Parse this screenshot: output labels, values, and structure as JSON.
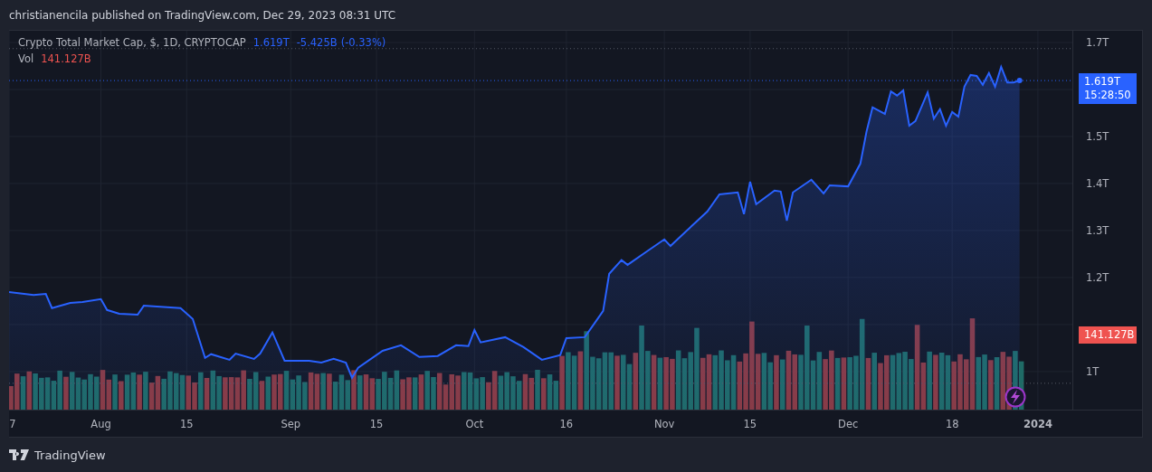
{
  "header": {
    "text": "christianencila published on TradingView.com, Dec 29, 2023 08:31 UTC"
  },
  "legend": {
    "price": "1.619T",
    "change": "-5.425B",
    "change_percent": "(-0.33%)",
    "volume_label": "Vol",
    "volume": "141.127B"
  },
  "price_badge": {
    "price": "1.619T",
    "countdown": "15:28:50"
  },
  "volume_badge": {
    "value": "141.127B"
  },
  "chart": {
    "chart_data": {
      "type": "area",
      "xlim": [
        "2023-07-17",
        "2024-01-18"
      ],
      "ylim": [
        0.919,
        1.725
      ],
      "grid": true,
      "ref_lines": [
        {
          "axis": "y",
          "value": 1.687,
          "color": "#555a66"
        },
        {
          "axis": "y",
          "value": 1.619,
          "color": "#2962ff"
        },
        {
          "axis": "y",
          "value": 0.975,
          "color": "#555a66"
        }
      ],
      "x": [
        "2023-07-17",
        "2023-07-21",
        "2023-07-23",
        "2023-07-24",
        "2023-07-27",
        "2023-07-29",
        "2023-08-01",
        "2023-08-02",
        "2023-08-04",
        "2023-08-07",
        "2023-08-08",
        "2023-08-14",
        "2023-08-16",
        "2023-08-18",
        "2023-08-19",
        "2023-08-22",
        "2023-08-23",
        "2023-08-26",
        "2023-08-27",
        "2023-08-29",
        "2023-08-31",
        "2023-09-04",
        "2023-09-06",
        "2023-09-08",
        "2023-09-10",
        "2023-09-11",
        "2023-09-12",
        "2023-09-16",
        "2023-09-19",
        "2023-09-22",
        "2023-09-25",
        "2023-09-28",
        "2023-09-30",
        "2023-10-01",
        "2023-10-02",
        "2023-10-06",
        "2023-10-09",
        "2023-10-12",
        "2023-10-15",
        "2023-10-16",
        "2023-10-19",
        "2023-10-21",
        "2023-10-22",
        "2023-10-23",
        "2023-10-25",
        "2023-10-26",
        "2023-10-29",
        "2023-11-01",
        "2023-11-02",
        "2023-11-05",
        "2023-11-08",
        "2023-11-10",
        "2023-11-13",
        "2023-11-14",
        "2023-11-15",
        "2023-11-16",
        "2023-11-19",
        "2023-11-20",
        "2023-11-21",
        "2023-11-22",
        "2023-11-25",
        "2023-11-27",
        "2023-11-28",
        "2023-12-01",
        "2023-12-03",
        "2023-12-04",
        "2023-12-05",
        "2023-12-07",
        "2023-12-08",
        "2023-12-09",
        "2023-12-10",
        "2023-12-11",
        "2023-12-12",
        "2023-12-14",
        "2023-12-15",
        "2023-12-16",
        "2023-12-17",
        "2023-12-18",
        "2023-12-19",
        "2023-12-20",
        "2023-12-21",
        "2023-12-22",
        "2023-12-23",
        "2023-12-24",
        "2023-12-25",
        "2023-12-26",
        "2023-12-27",
        "2023-12-28",
        "2023-12-29"
      ],
      "series": [
        {
          "name": "Crypto Total Market Cap, $, 1D, CRYPTOCAP",
          "color": "#2962ff",
          "values": [
            1.169,
            1.163,
            1.165,
            1.135,
            1.146,
            1.148,
            1.154,
            1.131,
            1.123,
            1.121,
            1.14,
            1.135,
            1.112,
            1.029,
            1.037,
            1.025,
            1.038,
            1.027,
            1.038,
            1.083,
            1.023,
            1.023,
            1.019,
            1.027,
            1.019,
            0.987,
            1.008,
            1.044,
            1.056,
            1.031,
            1.033,
            1.056,
            1.054,
            1.088,
            1.062,
            1.073,
            1.052,
            1.025,
            1.035,
            1.071,
            1.073,
            1.11,
            1.129,
            1.208,
            1.237,
            1.227,
            1.254,
            1.281,
            1.267,
            1.304,
            1.34,
            1.377,
            1.381,
            1.335,
            1.404,
            1.356,
            1.385,
            1.383,
            1.321,
            1.381,
            1.408,
            1.379,
            1.396,
            1.394,
            1.442,
            1.51,
            1.562,
            1.548,
            1.596,
            1.587,
            1.598,
            1.523,
            1.533,
            1.594,
            1.538,
            1.558,
            1.523,
            1.552,
            1.542,
            1.606,
            1.631,
            1.629,
            1.61,
            1.635,
            1.606,
            1.648,
            1.615,
            1.615,
            1.619
          ]
        }
      ],
      "yticks": [
        {
          "value": 1,
          "label": "1T"
        },
        {
          "value": 1.2,
          "label": "1.2T"
        },
        {
          "value": 1.3,
          "label": "1.3T"
        },
        {
          "value": 1.4,
          "label": "1.4T"
        },
        {
          "value": 1.5,
          "label": "1.5T"
        },
        {
          "value": 1.7,
          "label": "1.7T"
        }
      ],
      "xticks": [
        {
          "value": "2023-07-17",
          "label": "7"
        },
        {
          "value": "2023-08-01",
          "label": "Aug"
        },
        {
          "value": "2023-08-15",
          "label": "15"
        },
        {
          "value": "2023-09-01",
          "label": "Sep"
        },
        {
          "value": "2023-09-15",
          "label": "15"
        },
        {
          "value": "2023-10-01",
          "label": "Oct"
        },
        {
          "value": "2023-10-16",
          "label": "16"
        },
        {
          "value": "2023-11-01",
          "label": "Nov"
        },
        {
          "value": "2023-11-15",
          "label": "15"
        },
        {
          "value": "2023-12-01",
          "label": "Dec"
        },
        {
          "value": "2023-12-18",
          "label": "18"
        },
        {
          "value": "2024-01-01",
          "label": "2024"
        }
      ]
    }
  },
  "footer": {
    "brand": "TradingView"
  }
}
